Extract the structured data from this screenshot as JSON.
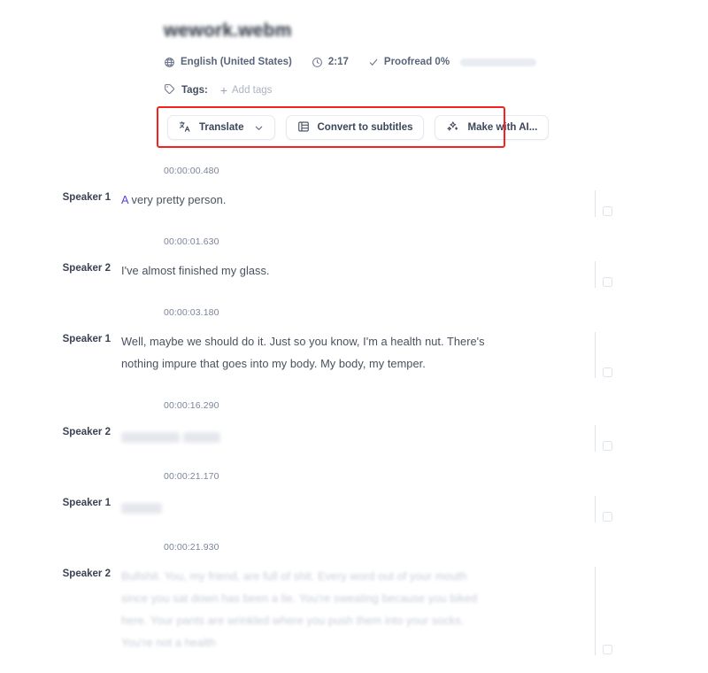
{
  "document": {
    "title": "wework.webm",
    "meta": {
      "language": "English (United States)",
      "duration": "2:17",
      "proofread": "Proofread 0%"
    },
    "tags": {
      "label": "Tags:",
      "add_label": "Add tags",
      "plus": "+"
    }
  },
  "toolbar": {
    "translate": "Translate",
    "convert_to_subtitles": "Convert to subtitles",
    "make_with_ai": "Make with AI...",
    "highlight_color": "#f4231f"
  },
  "transcript": {
    "segments": [
      {
        "time": "00:00:00.480",
        "speaker": "Speaker 1",
        "highlight_word": "A",
        "text": " very pretty person.",
        "state": "normal"
      },
      {
        "time": "00:00:01.630",
        "speaker": "Speaker 2",
        "highlight_word": "",
        "text": "I've almost finished my glass.",
        "state": "normal"
      },
      {
        "time": "00:00:03.180",
        "speaker": "Speaker 1",
        "highlight_word": "",
        "text": "Well, maybe we should do it. Just so you know, I'm a health nut. There's nothing impure that goes into my body. My body, my temper.",
        "state": "normal"
      },
      {
        "time": "00:00:16.290",
        "speaker": "Speaker 2",
        "highlight_word": "",
        "text": "",
        "state": "redacted"
      },
      {
        "time": "00:00:21.170",
        "speaker": "Speaker 1",
        "highlight_word": "",
        "text": "",
        "state": "redacted-short"
      },
      {
        "time": "00:00:21.930",
        "speaker": "Speaker 2",
        "highlight_word": "",
        "text": "Bullshit. You, my friend, are full of shit. Every word out of your mouth since you sat down has been a lie. You're sweating because you biked here. Your pants are wrinkled where you push them into your socks. You're not a health",
        "state": "faded"
      }
    ]
  },
  "colors": {
    "accent_blue": "#5045d6",
    "text_primary": "#3b4252",
    "text_muted": "#7b8699",
    "border": "#e6e9ef"
  }
}
